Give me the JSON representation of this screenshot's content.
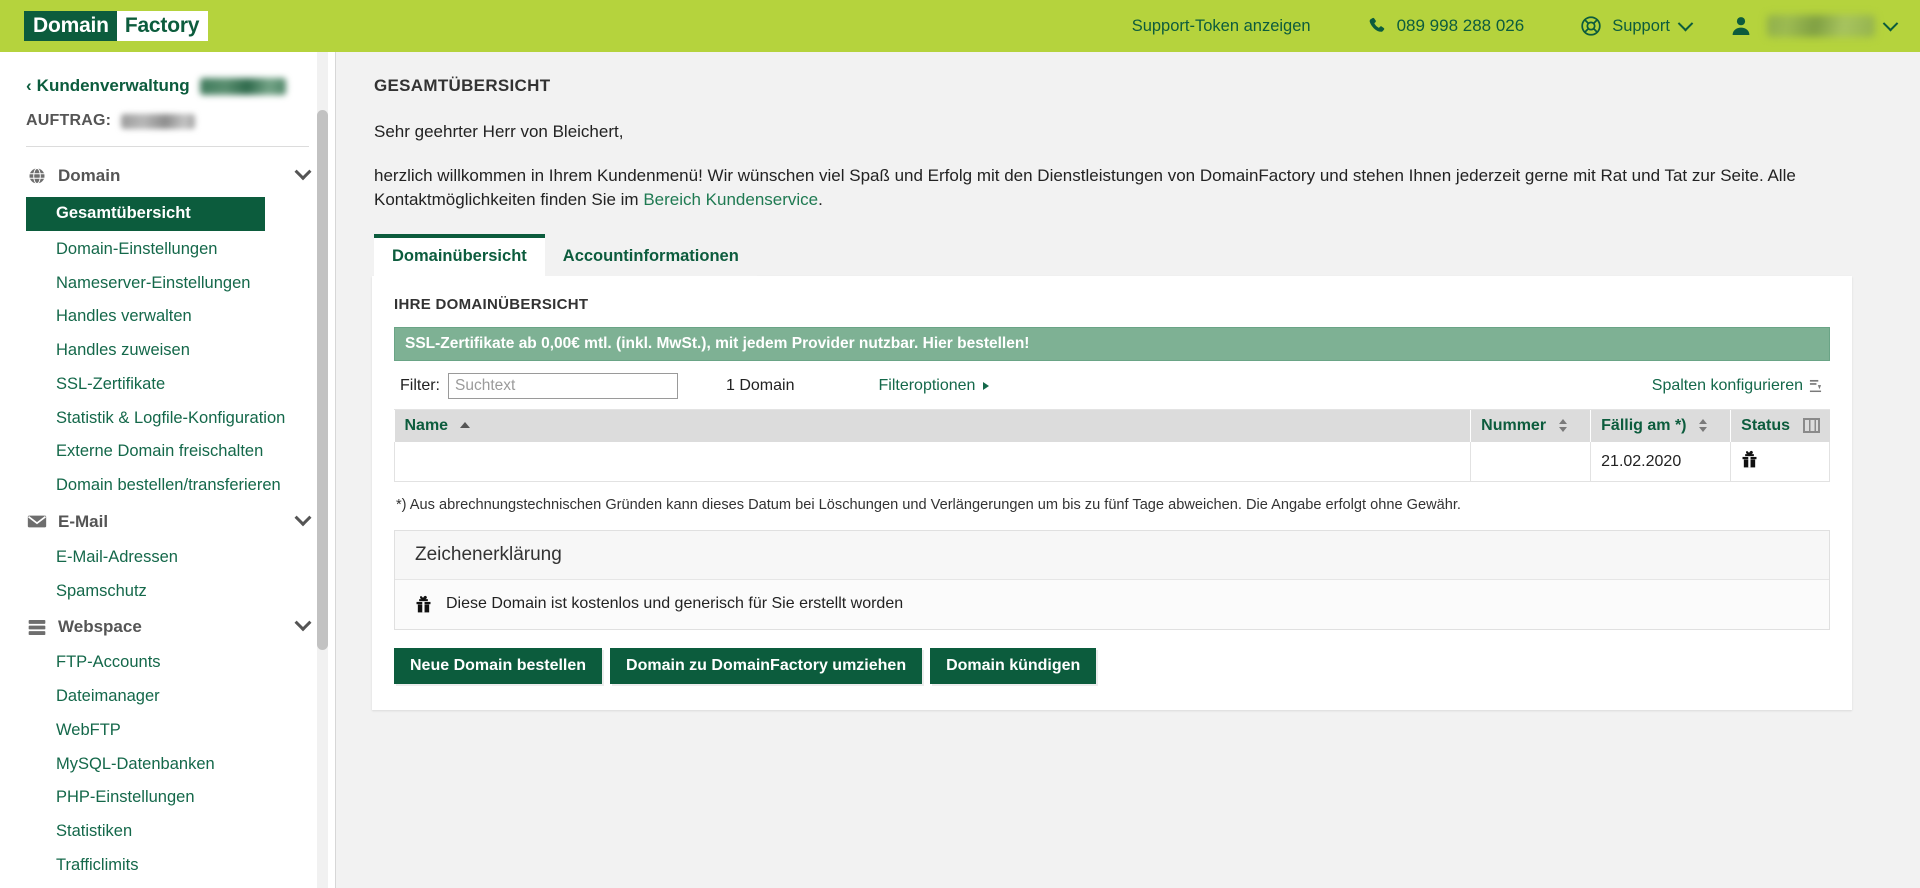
{
  "header": {
    "logo_part1": "Domain",
    "logo_part2": "Factory",
    "support_token": "Support-Token anzeigen",
    "phone": "089 998 288 026",
    "support": "Support",
    "brand_green": "#b5d33d",
    "dark_green": "#0c5c3d"
  },
  "sidebar": {
    "back_label": "Kundenverwaltung",
    "order_label": "AUFTRAG:",
    "groups": [
      {
        "label": "Domain",
        "icon": "globe-icon",
        "items": [
          "Gesamtübersicht",
          "Domain-Einstellungen",
          "Nameserver-Einstellungen",
          "Handles verwalten",
          "Handles zuweisen",
          "SSL-Zertifikate",
          "Statistik & Logfile-Konfiguration",
          "Externe Domain freischalten",
          "Domain bestellen/transferieren"
        ]
      },
      {
        "label": "E-Mail",
        "icon": "envelope-icon",
        "items": [
          "E-Mail-Adressen",
          "Spamschutz"
        ]
      },
      {
        "label": "Webspace",
        "icon": "server-icon",
        "items": [
          "FTP-Accounts",
          "Dateimanager",
          "WebFTP",
          "MySQL-Datenbanken",
          "PHP-Einstellungen",
          "Statistiken",
          "Trafficlimits"
        ]
      }
    ],
    "active_item": "Gesamtübersicht"
  },
  "main": {
    "page_title": "GESAMTÜBERSICHT",
    "greeting": "Sehr geehrter Herr von Bleichert,",
    "welcome_before": "herzlich willkommen in Ihrem Kundenmenü! Wir wünschen viel Spaß und Erfolg mit den Dienstleistungen von DomainFactory und stehen Ihnen jederzeit gerne mit Rat und Tat zur Seite. Alle Kontaktmöglichkeiten finden Sie im ",
    "welcome_link": "Bereich Kundenservice",
    "welcome_after": ".",
    "tabs": [
      {
        "label": "Domainübersicht",
        "active": true
      },
      {
        "label": "Accountinformationen",
        "active": false
      }
    ],
    "panel_title": "IHRE DOMAINÜBERSICHT",
    "ssl_banner": "SSL-Zertifikate ab 0,00€ mtl. (inkl. MwSt.), mit jedem Provider nutzbar. Hier bestellen!",
    "filter_label": "Filter:",
    "filter_placeholder": "Suchtext",
    "filter_value": "",
    "domain_count": "1 Domain",
    "filter_options": "Filteroptionen",
    "configure_columns": "Spalten konfigurieren",
    "table": {
      "columns": [
        "Name",
        "Nummer",
        "Fällig am *)",
        "Status"
      ],
      "sort_column": "Name",
      "sort_direction": "asc",
      "rows": [
        {
          "name": "",
          "nummer": "",
          "faellig_am": "21.02.2020",
          "status_icon": "gift-icon"
        }
      ]
    },
    "footnote": "*) Aus abrechnungstechnischen Gründen kann dieses Datum bei Löschungen und Verlängerungen um bis zu fünf Tage abweichen. Die Angabe erfolgt ohne Gewähr.",
    "legend_title": "Zeichenerklärung",
    "legend_entry": "Diese Domain ist kostenlos und generisch für Sie erstellt worden",
    "legend_icon": "gift-icon",
    "buttons": [
      "Neue Domain bestellen",
      "Domain zu DomainFactory umziehen",
      "Domain kündigen"
    ]
  }
}
